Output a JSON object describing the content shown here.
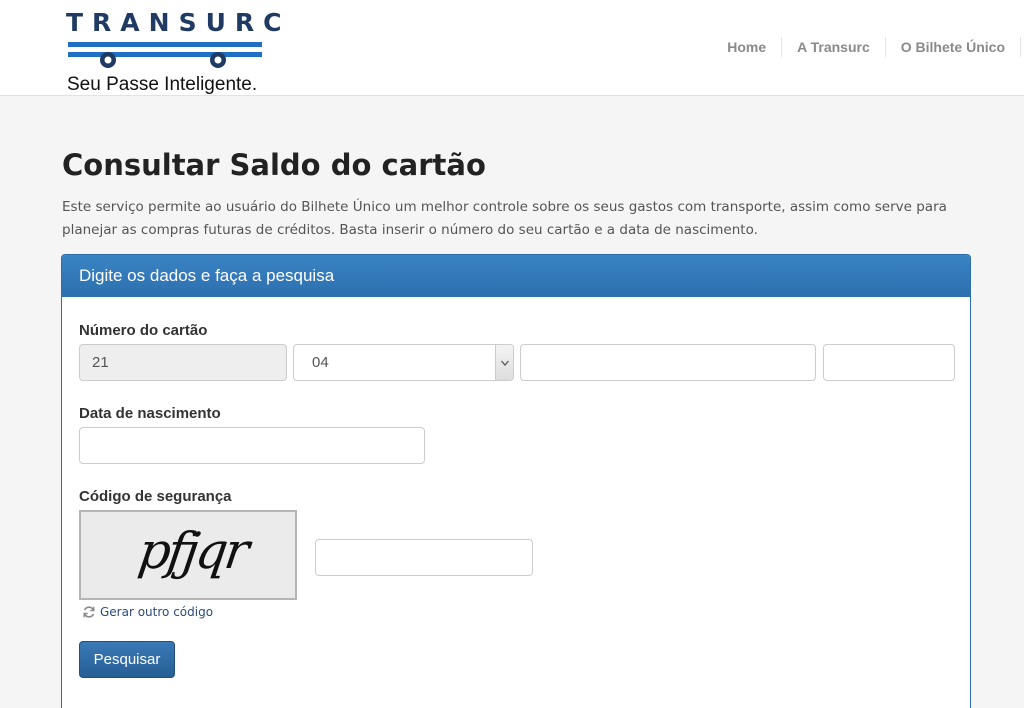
{
  "brand": {
    "logo_text": "TRANSURC",
    "tagline": "Seu Passe Inteligente."
  },
  "nav": {
    "items": [
      "Home",
      "A Transurc",
      "O Bilhete Único"
    ]
  },
  "page": {
    "title": "Consultar Saldo do cartão",
    "intro": "Este serviço permite ao usuário do Bilhete Único um melhor controle sobre os seus gastos com transporte, assim como serve para planejar as compras futuras de créditos. Basta inserir o número do seu cartão e a data de nascimento."
  },
  "form": {
    "panel_title": "Digite os dados e faça a pesquisa",
    "card_label": "Número do cartão",
    "card_prefix": "21",
    "card_select": "04",
    "card_field3": "",
    "card_field4": "",
    "birth_label": "Data de nascimento",
    "birth_value": "",
    "security_label": "Código de segurança",
    "captcha_text": "pfjqr",
    "captcha_input": "",
    "refresh_label": "Gerar outro código",
    "submit_label": "Pesquisar"
  },
  "colors": {
    "panel_header": "#3a84c4",
    "button": "#2f6ca6",
    "logo_blue": "#1f6fc4",
    "logo_navy": "#1f3a63"
  }
}
